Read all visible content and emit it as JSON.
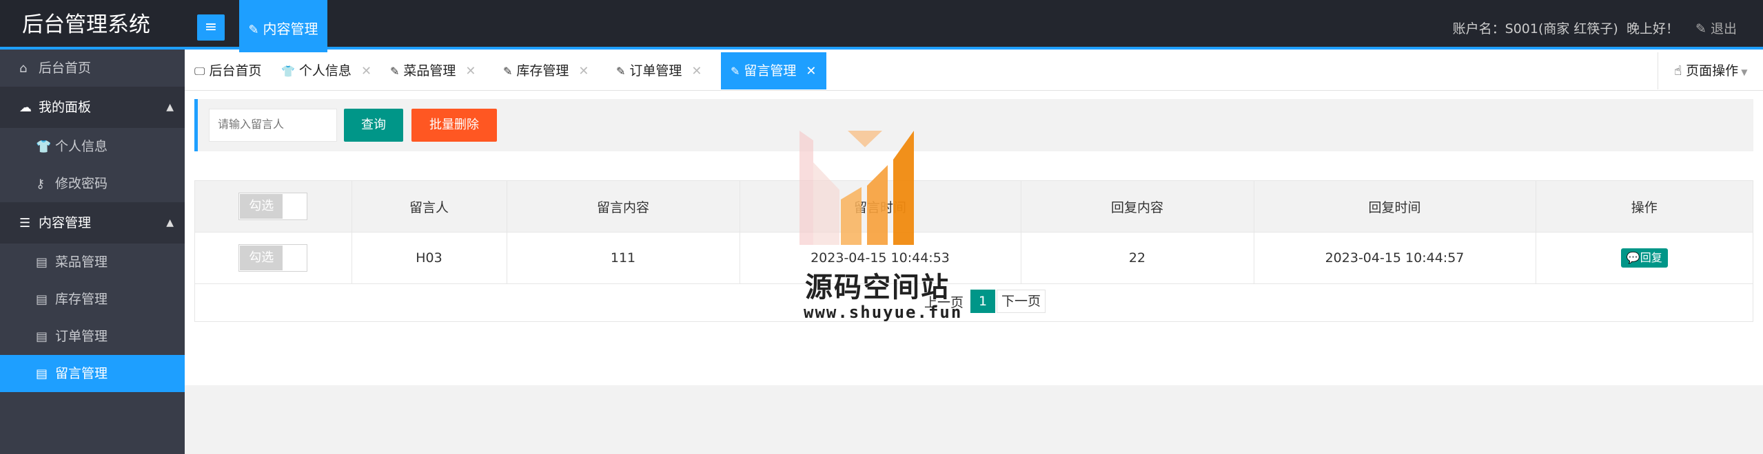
{
  "header": {
    "app_title": "后台管理系统",
    "menu_toggle": "≡",
    "top_nav": "内容管理",
    "account_label": "账户名：S001(商家 红筷子)",
    "greeting": "晚上好！",
    "logout": "退出"
  },
  "sidebar": {
    "items": [
      {
        "label": "后台首页",
        "icon": "home-icon",
        "type": "item"
      },
      {
        "label": "我的面板",
        "icon": "weather-icon",
        "type": "group"
      },
      {
        "label": "个人信息",
        "icon": "shirt-icon",
        "type": "sub"
      },
      {
        "label": "修改密码",
        "icon": "user-lock-icon",
        "type": "sub"
      },
      {
        "label": "内容管理",
        "icon": "list-icon",
        "type": "group"
      },
      {
        "label": "菜品管理",
        "icon": "doc-icon",
        "type": "sub"
      },
      {
        "label": "库存管理",
        "icon": "doc-icon",
        "type": "sub"
      },
      {
        "label": "订单管理",
        "icon": "doc-icon",
        "type": "sub"
      },
      {
        "label": "留言管理",
        "icon": "doc-icon",
        "type": "sub",
        "active": true
      }
    ]
  },
  "tabs": [
    {
      "label": "后台首页",
      "icon": "monitor-icon"
    },
    {
      "label": "个人信息",
      "icon": "shirt-icon"
    },
    {
      "label": "菜品管理",
      "icon": "feather-icon"
    },
    {
      "label": "库存管理",
      "icon": "feather-icon"
    },
    {
      "label": "订单管理",
      "icon": "feather-icon"
    },
    {
      "label": "留言管理",
      "icon": "feather-icon",
      "active": true
    }
  ],
  "page_ops": "页面操作",
  "search": {
    "placeholder": "请输入留言人",
    "query_button": "查询",
    "batch_delete_button": "批量删除"
  },
  "table": {
    "switch_label": "勾选",
    "columns": [
      "勾选",
      "留言人",
      "留言内容",
      "留言时间",
      "回复内容",
      "回复时间",
      "操作"
    ],
    "rows": [
      {
        "checkbox": "勾选",
        "author": "H03",
        "content": "111",
        "time": "2023-04-15 10:44:53",
        "reply": "22",
        "reply_time": "2023-04-15 10:44:57",
        "action": "回复"
      }
    ]
  },
  "pager": {
    "prev": "上一页",
    "current": "1",
    "next": "下一页"
  },
  "watermark": {
    "text": "源码空间站",
    "url": "www.shuyue.fun"
  },
  "colors": {
    "accent": "#1e9fff",
    "header_bg": "#23262e",
    "sidebar_bg": "#393d49",
    "primary_btn": "#009688",
    "danger_btn": "#ff5722"
  }
}
